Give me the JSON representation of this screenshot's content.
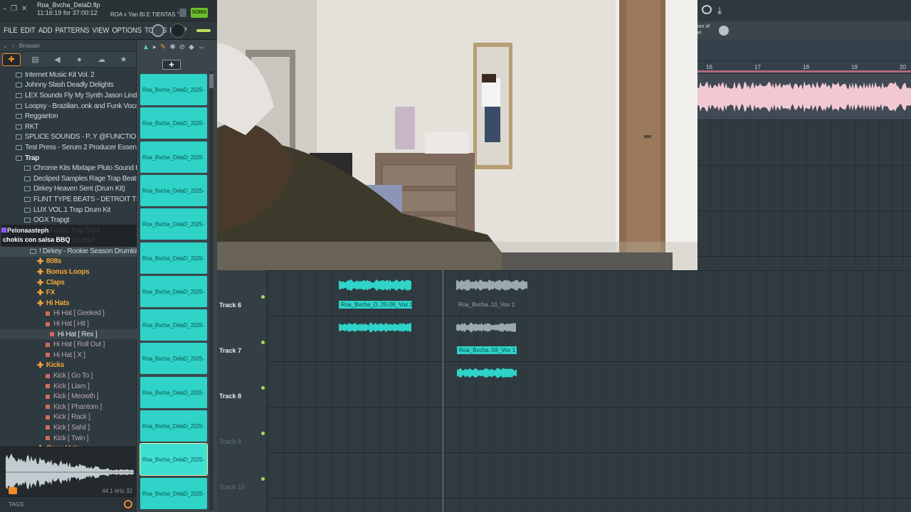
{
  "titlebar": {
    "project": "Roa_Bvcha_DelaD.flp",
    "time": "11:16:19 for 37:00:12",
    "hint": "ROA x Yan BI.E TIENTAS \"",
    "song_label": "SONG"
  },
  "menubar": {
    "items": [
      "FILE",
      "EDIT",
      "ADD",
      "PATTERNS",
      "VIEW",
      "OPTIONS",
      "TOOLS",
      "HELP"
    ]
  },
  "browser": {
    "header": "Browser",
    "tree": [
      {
        "label": "Internet Music Kit Vol. 2",
        "kind": "folder"
      },
      {
        "label": "Johnny Slash Deadly Delights",
        "kind": "folder"
      },
      {
        "label": "LEX Sounds Fly My Synth Jason Lindner",
        "kind": "folder"
      },
      {
        "label": "Loopsy - Brazilian..onk and Funk Vocals",
        "kind": "folder"
      },
      {
        "label": "Reggaeton",
        "kind": "folder"
      },
      {
        "label": "RKT",
        "kind": "folder"
      },
      {
        "label": "SPLICE SOUNDS - P..Y @FUNCTION LLOPS",
        "kind": "folder"
      },
      {
        "label": "Test Press - Serum 2 Producer Essentials",
        "kind": "folder"
      },
      {
        "label": "Trap",
        "kind": "open"
      },
      {
        "label": "Chrome Kits Mixtape Pluto Sound Kit",
        "kind": "sub"
      },
      {
        "label": "Decliped Samples Rage Trap Beats",
        "kind": "sub"
      },
      {
        "label": "Dirkey Heaven Sent (Drum Kit)",
        "kind": "sub"
      },
      {
        "label": "FLINT TYPE BEATS - DETROIT TRAP",
        "kind": "sub"
      },
      {
        "label": "LUX VOL.1 Trap Drum Kit",
        "kind": "sub"
      },
      {
        "label": "OGX Trapgt",
        "kind": "sub"
      },
      {
        "label": "Masler ..Future Trap Soul",
        "kind": "dim"
      },
      {
        "label": "Rookie Season Drumkit",
        "kind": "dim"
      },
      {
        "label": "! Dirkey - Rookie Season Drumkit",
        "kind": "sub2"
      },
      {
        "label": "808s",
        "kind": "orange"
      },
      {
        "label": "Bonus Loops",
        "kind": "orange"
      },
      {
        "label": "Claps",
        "kind": "orange"
      },
      {
        "label": "FX",
        "kind": "orange"
      },
      {
        "label": "Hi Hats",
        "kind": "orange"
      },
      {
        "label": "Hi Hat [ Geeked ]",
        "kind": "file"
      },
      {
        "label": "Hi Hat [ Hit ]",
        "kind": "file"
      },
      {
        "label": "Hi Hat [ Rex ]",
        "kind": "filesel"
      },
      {
        "label": "Hi Hat [ Roll Out ]",
        "kind": "file"
      },
      {
        "label": "Hi Hat [ X ]",
        "kind": "file"
      },
      {
        "label": "Kicks",
        "kind": "orange"
      },
      {
        "label": "Kick [ Go To ]",
        "kind": "file"
      },
      {
        "label": "Kick [ Liam ]",
        "kind": "file"
      },
      {
        "label": "Kick [ Meowth ]",
        "kind": "file"
      },
      {
        "label": "Kick [ Phantom ]",
        "kind": "file"
      },
      {
        "label": "Kick [ Rack ]",
        "kind": "file"
      },
      {
        "label": "Kick [ Sahil ]",
        "kind": "file"
      },
      {
        "label": "Kick [ Twin ]",
        "kind": "file"
      },
      {
        "label": "Open Hats",
        "kind": "orange"
      }
    ],
    "sample_rate": "44.1 kHz 32",
    "tags_label": "TAGS"
  },
  "chat": {
    "user": "Pelonaasteph",
    "message": "chokis con salsa BBQ"
  },
  "rack": {
    "clip_label": "Roa_Bvcha_DelaD_2025-",
    "clip_count": 13,
    "selected_index": 11
  },
  "playlist": {
    "tracks": [
      {
        "name": "Track 6"
      },
      {
        "name": "Track 7"
      },
      {
        "name": "Track 8"
      },
      {
        "name": "Track 9"
      },
      {
        "name": "Track 10"
      }
    ],
    "clips": [
      {
        "label": "Roa_Bvcha_D..20-26_Vox 1",
        "style": "teal"
      },
      {
        "label": "Roa_Bvcha..10_Vox 1",
        "style": "grey"
      },
      {
        "label": "Roa_Bvcha..59_Vox 1",
        "style": "teal"
      }
    ],
    "ruler_bars": [
      "16",
      "17",
      "18",
      "19",
      "20"
    ]
  },
  "right_panel": {
    "hint": "ion of\ne!"
  },
  "colors": {
    "accent_orange": "#f08a24",
    "clip_teal": "#2fd3c8",
    "wave_pink": "#f2c9d3",
    "song_green": "#6bbd2e"
  }
}
